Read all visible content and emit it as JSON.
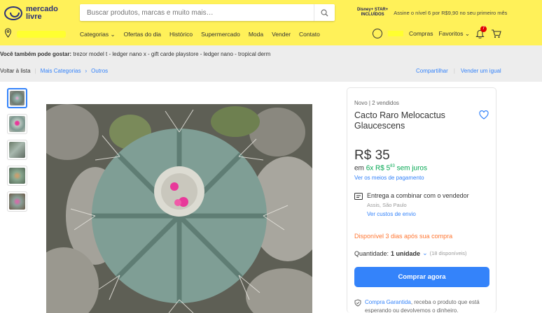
{
  "header": {
    "logo_line1": "mercado",
    "logo_line2": "livre",
    "search_placeholder": "Buscar produtos, marcas e muito mais…",
    "promo_logo_line1": "Disney+ STAR+",
    "promo_logo_line2": "INCLUÍDOS",
    "promo_text": "Assine o nível 6 por R$9,90 no seu primeiro mês",
    "nav": [
      "Categorias",
      "Ofertas do dia",
      "Histórico",
      "Supermercado",
      "Moda",
      "Vender",
      "Contato"
    ],
    "purchases": "Compras",
    "favorites": "Favoritos",
    "notif_count": "7"
  },
  "suggestions": {
    "label": "Você também pode gostar:",
    "items": "trezor model t - ledger nano x - gift carde playstore - ledger nano - tropical derm"
  },
  "breadcrumb": {
    "back": "Voltar à lista",
    "category": "Mais Categorias",
    "subcategory": "Outros",
    "share": "Compartilhar",
    "sell_same": "Vender um igual"
  },
  "product": {
    "condition": "Novo | 2 vendidos",
    "title": "Cacto Raro Melocactus Glaucescens",
    "price": "R$ 35",
    "installments_prefix": "em",
    "installments_green": "6x R$ 5",
    "installments_cents": "83",
    "installments_suffix": "sem juros",
    "payment_link": "Ver os meios de pagamento",
    "delivery": "Entrega a combinar com o vendedor",
    "city": "Assis, São Paulo",
    "costs_link": "Ver custos de envio",
    "stock": "Disponível 3 dias após sua compra",
    "qty_label": "Quantidade:",
    "qty_value": "1 unidade",
    "qty_available": "(18 disponíveis)",
    "buy_button": "Comprar agora",
    "guarantee_link": "Compra Garantida",
    "guarantee_text": ", receba o produto que está esperando ou devolvemos o dinheiro."
  },
  "colors": {
    "header_bg": "#fff159",
    "accent_blue": "#3483fa",
    "installment_green": "#00a650",
    "stock_orange": "#ff7733"
  }
}
